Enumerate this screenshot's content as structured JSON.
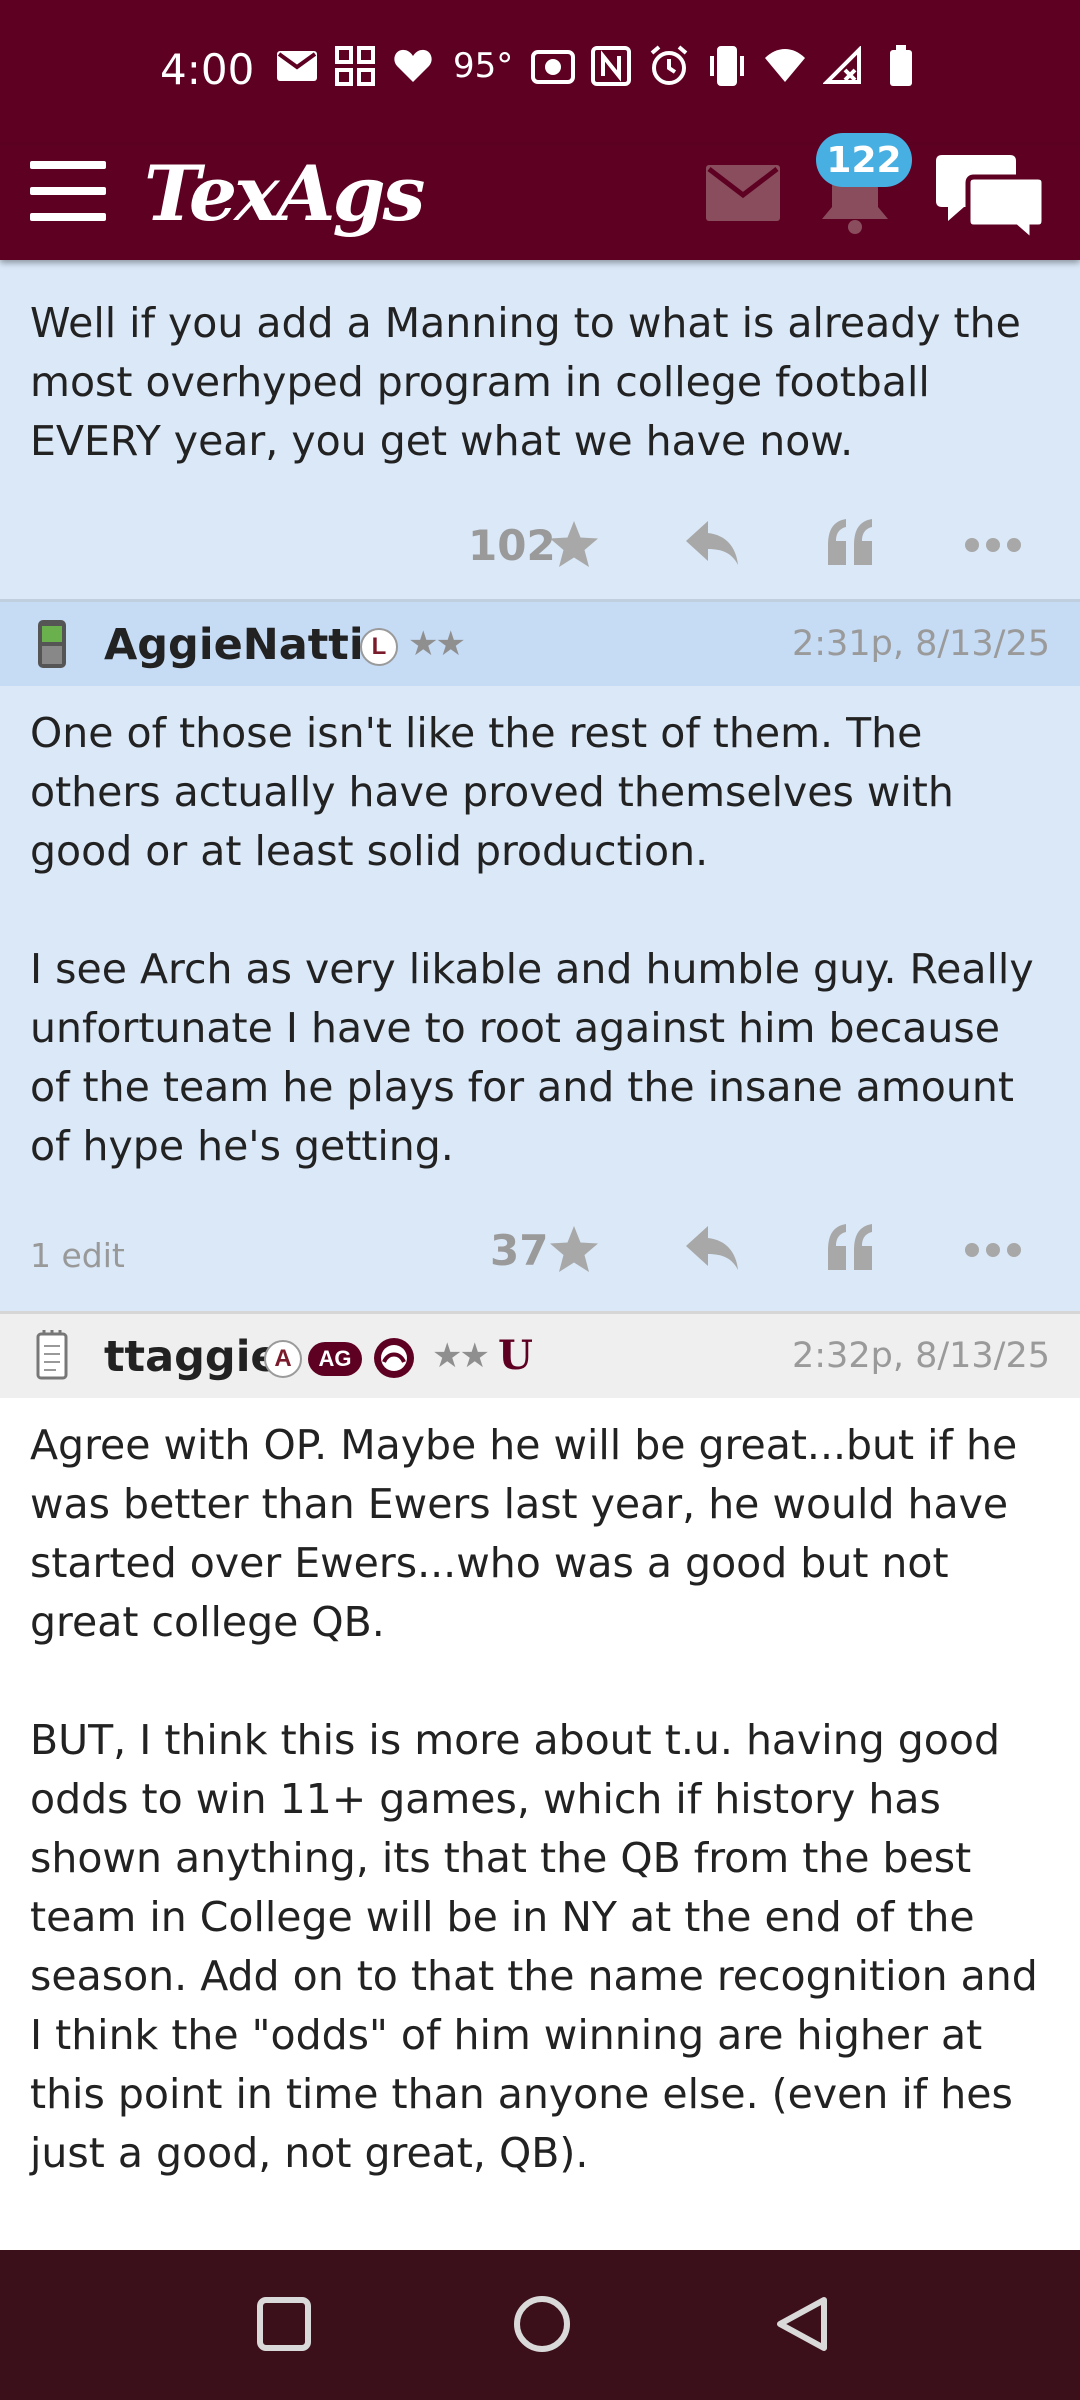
{
  "status_bar": {
    "time": "4:00",
    "temperature": "95°",
    "icons": [
      "mail-icon",
      "grid-app-icon",
      "heart-icon",
      "camera-icon",
      "nfc-icon",
      "alarm-icon",
      "vibrate-icon",
      "wifi-icon",
      "signal-icon",
      "battery-icon"
    ]
  },
  "app_bar": {
    "logo": "TexAgs",
    "notification_count": "122",
    "colors": {
      "maroon": "#5e0022",
      "badge_blue": "#47afe2"
    }
  },
  "posts": [
    {
      "body": "Well if you add a Manning to what is already the most overhyped program in college football EVERY year, you get what we have now.",
      "stars": "102"
    },
    {
      "username": "AggieNattie",
      "badge": "L",
      "rank_stars": "★★",
      "timestamp": "2:31p, 8/13/25",
      "body": "One of those isn't like the rest of them. The others actually have proved themselves with good or at least solid production.\n\nI see Arch as very likable and humble guy. Really unfortunate I have to root against him because of the team he plays for and the insane amount of hype he's getting.",
      "edits": "1 edit",
      "stars": "37"
    },
    {
      "username": "ttaggie",
      "badge": "A",
      "badge2": "AG",
      "rank_stars": "★★",
      "badge_u": "U",
      "timestamp": "2:32p, 8/13/25",
      "body": "Agree with OP. Maybe he will be great...but if he was better than Ewers last year, he would have started over Ewers...who was a good but not great college QB.\n\nBUT, I think this is more about t.u. having good odds to win 11+ games, which if history has shown anything, its that the QB from the best team in College will be in NY at the end of the season. Add on to that the name recognition and I think the \"odds\" of him winning are higher at this point in time than anyone else. (even if hes just a good, not great, QB)."
    }
  ],
  "nav_bar": {
    "buttons": [
      "recents-square-icon",
      "home-circle-icon",
      "back-triangle-icon"
    ]
  }
}
